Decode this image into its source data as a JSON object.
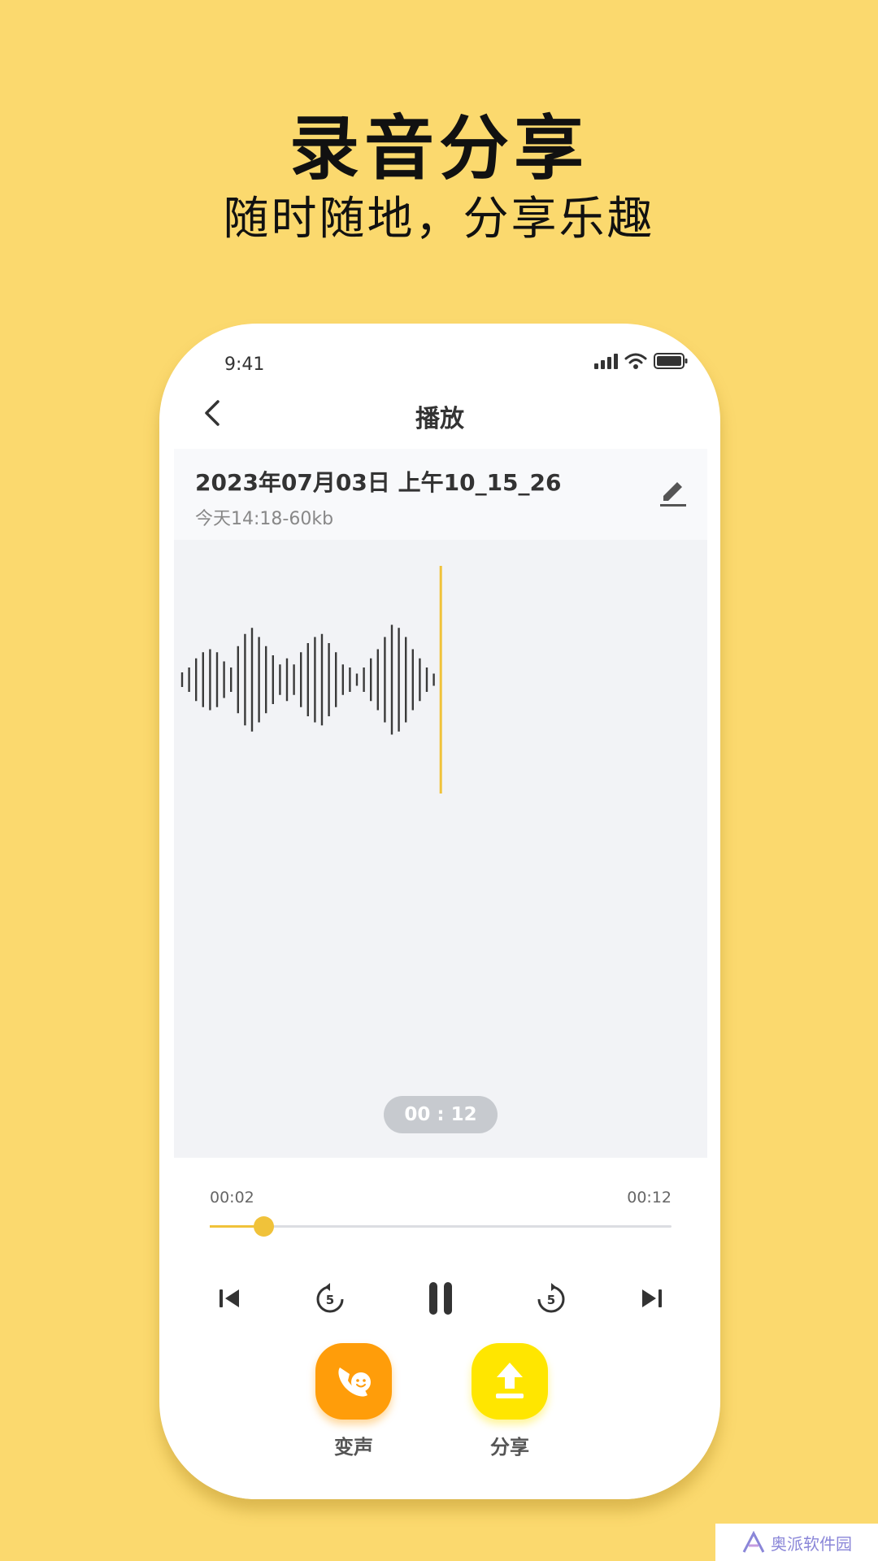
{
  "promo": {
    "title": "录音分享",
    "subtitle": "随时随地，分享乐趣"
  },
  "status_bar": {
    "time": "9:41",
    "icons": [
      "signal-icon",
      "wifi-icon",
      "battery-icon"
    ]
  },
  "nav": {
    "title": "播放",
    "back_icon": "chevron-left-icon"
  },
  "recording": {
    "name": "2023年07月03日 上午10_15_26",
    "meta": "今天14:18-60kb",
    "edit_icon": "pencil-icon"
  },
  "waveform": {
    "amplitudes": [
      0.12,
      0.2,
      0.35,
      0.45,
      0.5,
      0.45,
      0.3,
      0.2,
      0.55,
      0.75,
      0.85,
      0.7,
      0.55,
      0.4,
      0.25,
      0.35,
      0.25,
      0.45,
      0.6,
      0.7,
      0.75,
      0.6,
      0.45,
      0.25,
      0.2,
      0.1,
      0.2,
      0.35,
      0.5,
      0.7,
      0.9,
      0.85,
      0.7,
      0.5,
      0.35,
      0.2,
      0.1
    ]
  },
  "timer_pill": "00 : 12",
  "player": {
    "elapsed": "00:02",
    "duration": "00:12",
    "progress_fraction": 0.1167,
    "controls": [
      "skip-previous-icon",
      "rewind-5-icon",
      "pause-icon",
      "forward-5-icon",
      "skip-next-icon"
    ],
    "rewind_seconds": "5",
    "forward_seconds": "5"
  },
  "actions": [
    {
      "label": "变声",
      "icon": "voice-change-icon",
      "color": "#ff9d0a"
    },
    {
      "label": "分享",
      "icon": "upload-share-icon",
      "color": "#ffe600"
    }
  ],
  "colors": {
    "background": "#fbd96e",
    "accent": "#f0c23a",
    "playhead": "#f0c23a"
  },
  "watermark": "奥派软件园"
}
